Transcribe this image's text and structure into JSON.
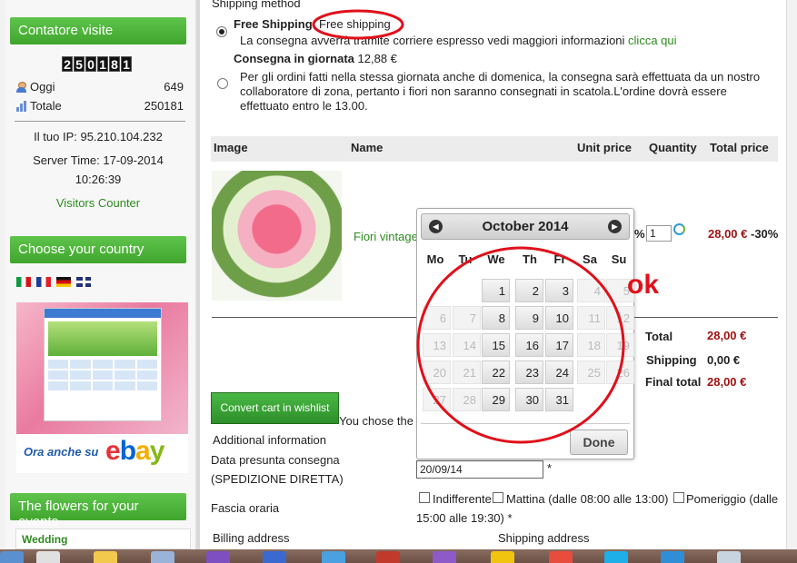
{
  "sidebar": {
    "visitor_box_title": "Contatore visite",
    "counter_digits": [
      "2",
      "5",
      "0",
      "1",
      "8",
      "1"
    ],
    "today_label": "Oggi",
    "today_value": "649",
    "total_label": "Totale",
    "total_value": "250181",
    "ip_line": "Il tuo IP: 95.210.104.232",
    "server_time_line": "Server Time: 17-09-2014",
    "server_clock": "10:26:39",
    "visitors_counter_link": "Visitors Counter",
    "country_box_title": "Choose your country",
    "flags": [
      "flag-italy-icon",
      "flag-france-icon",
      "flag-germany-icon",
      "flag-uk-icon"
    ],
    "ad_tagline": "Ora anche su",
    "ad_brand": "ebay",
    "events_box_title": "The flowers for your events",
    "events_first_item": "Wedding"
  },
  "shipping": {
    "section_label": "Shipping method",
    "option1_title": "Free Shipping",
    "option1_tag": "Free shipping",
    "option1_desc": "La consegna avverrà tramite corriere espresso vedi maggiori informazioni",
    "option1_link": "clicca qui",
    "option2_title": "Consegna in giornata",
    "option2_price": "12,88 €",
    "option2_desc_line1": "Per gli ordini fatti nella stessa giornata anche di domenica, la consegna sarà effettuata da un nostro",
    "option2_desc_line2": "collaboratore di zona, pertanto i fiori non saranno consegnati in scatola.L'ordine dovrà essere",
    "option2_desc_line3": "effettuato entro le 13.00."
  },
  "cart": {
    "headers": {
      "image": "Image",
      "name": "Name",
      "unit_price": "Unit price",
      "quantity": "Quantity",
      "total_price": "Total price"
    },
    "item_name": "Fiori vintage",
    "item_percent_fragment": "%",
    "item_qty": "1",
    "item_total": "28,00 €",
    "item_discount": "-30%",
    "total_label": "Total",
    "total_value": "28,00 €",
    "shipping_label": "Shipping",
    "shipping_value": "0,00 €",
    "final_label": "Final total",
    "final_value": "28,00 €",
    "wishlist_button": "Convert cart in wishlist",
    "chose_text": "You chose the"
  },
  "form": {
    "additional_info": "Additional information",
    "date_label_line1": "Data presunta consegna",
    "date_label_line2": "(SPEDIZIONE DIRETTA)",
    "date_value": "20/09/14",
    "required_mark": "*",
    "slot_label": "Fascia oraria",
    "slot_opt1": "Indifferente",
    "slot_opt2": "Mattina (dalle 08:00 alle 13:00)",
    "slot_opt3_line1": "Pomeriggio (dalle",
    "slot_opt3_line2": "15:00 alle 19:30) *",
    "billing_label": "Billing address",
    "shipping_label": "Shipping address"
  },
  "calendar": {
    "month_title": "October 2014",
    "weekdays": [
      "Mo",
      "Tu",
      "We",
      "Th",
      "Fr",
      "Sa",
      "Su"
    ],
    "done_label": "Done",
    "weeks": [
      [
        {
          "d": "",
          "a": false
        },
        {
          "d": "",
          "a": false
        },
        {
          "d": "1",
          "a": true
        },
        {
          "d": "2",
          "a": true
        },
        {
          "d": "3",
          "a": true
        },
        {
          "d": "4",
          "a": false
        },
        {
          "d": "5",
          "a": false
        }
      ],
      [
        {
          "d": "6",
          "a": false
        },
        {
          "d": "7",
          "a": false
        },
        {
          "d": "8",
          "a": true
        },
        {
          "d": "9",
          "a": true
        },
        {
          "d": "10",
          "a": true
        },
        {
          "d": "11",
          "a": false
        },
        {
          "d": "12",
          "a": false
        }
      ],
      [
        {
          "d": "13",
          "a": false
        },
        {
          "d": "14",
          "a": false
        },
        {
          "d": "15",
          "a": true
        },
        {
          "d": "16",
          "a": true
        },
        {
          "d": "17",
          "a": true
        },
        {
          "d": "18",
          "a": false
        },
        {
          "d": "19",
          "a": false
        }
      ],
      [
        {
          "d": "20",
          "a": false
        },
        {
          "d": "21",
          "a": false
        },
        {
          "d": "22",
          "a": true
        },
        {
          "d": "23",
          "a": true
        },
        {
          "d": "24",
          "a": true
        },
        {
          "d": "25",
          "a": false
        },
        {
          "d": "26",
          "a": false
        }
      ],
      [
        {
          "d": "27",
          "a": false
        },
        {
          "d": "28",
          "a": false
        },
        {
          "d": "29",
          "a": true
        },
        {
          "d": "30",
          "a": true
        },
        {
          "d": "31",
          "a": true
        },
        {
          "d": "",
          "a": false
        },
        {
          "d": "",
          "a": false
        }
      ]
    ]
  },
  "annotation": {
    "ok_text": "ok",
    "color": "#e0101a"
  },
  "colors": {
    "accent_green": "#3fa52c",
    "price_red": "#a01212",
    "link_green": "#2e8b1f"
  }
}
